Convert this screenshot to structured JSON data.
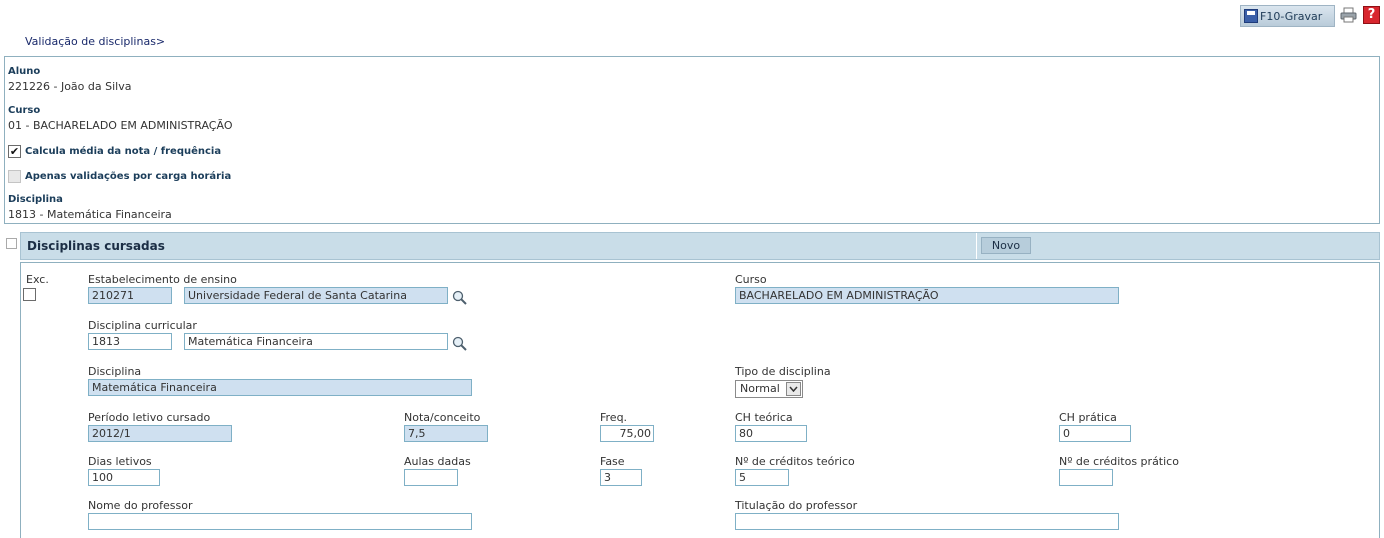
{
  "toolbar": {
    "save_label": "F10-Gravar",
    "print_icon": "printer-icon",
    "help_icon": "help-icon",
    "help_glyph": "?"
  },
  "breadcrumb": "Validação de disciplinas>",
  "aluno": {
    "aluno_label": "Aluno",
    "aluno_value": "221226 - João da Silva",
    "curso_label": "Curso",
    "curso_value": "01 - BACHARELADO EM ADMINISTRAÇÃO",
    "calcula_label": "Calcula média da nota / frequência",
    "calcula_checked": true,
    "check_glyph": "✔",
    "apenas_label": "Apenas validações por carga horária",
    "apenas_checked": false,
    "disciplina_label": "Disciplina",
    "disciplina_value": "1813 - Matemática Financeira"
  },
  "section": {
    "title": "Disciplinas cursadas",
    "novo_label": "Novo"
  },
  "form": {
    "exc_label": "Exc.",
    "estab_label": "Estabelecimento de ensino",
    "estab_code": "210271",
    "estab_name": "Universidade Federal de Santa Catarina",
    "curso_label": "Curso",
    "curso_value": "BACHARELADO EM ADMINISTRAÇÃO",
    "disc_curr_label": "Disciplina curricular",
    "disc_curr_code": "1813",
    "disc_curr_name": "Matemática Financeira",
    "disciplina_label": "Disciplina",
    "disciplina_value": "Matemática Financeira",
    "tipo_label": "Tipo de disciplina",
    "tipo_value": "Normal",
    "periodo_label": "Período letivo cursado",
    "periodo_value": "2012/1",
    "nota_label": "Nota/conceito",
    "nota_value": "7,5",
    "freq_label": "Freq.",
    "freq_value": "75,00",
    "ch_teorica_label": "CH teórica",
    "ch_teorica_value": "80",
    "ch_pratica_label": "CH prática",
    "ch_pratica_value": "0",
    "dias_label": "Dias letivos",
    "dias_value": "100",
    "aulas_label": "Aulas dadas",
    "aulas_value": "",
    "fase_label": "Fase",
    "fase_value": "3",
    "cred_teorico_label": "Nº de créditos teórico",
    "cred_teorico_value": "5",
    "cred_pratico_label": "Nº de créditos prático",
    "cred_pratico_value": "",
    "professor_label": "Nome do professor",
    "professor_value": "",
    "titulacao_label": "Titulação do professor",
    "titulacao_value": ""
  }
}
